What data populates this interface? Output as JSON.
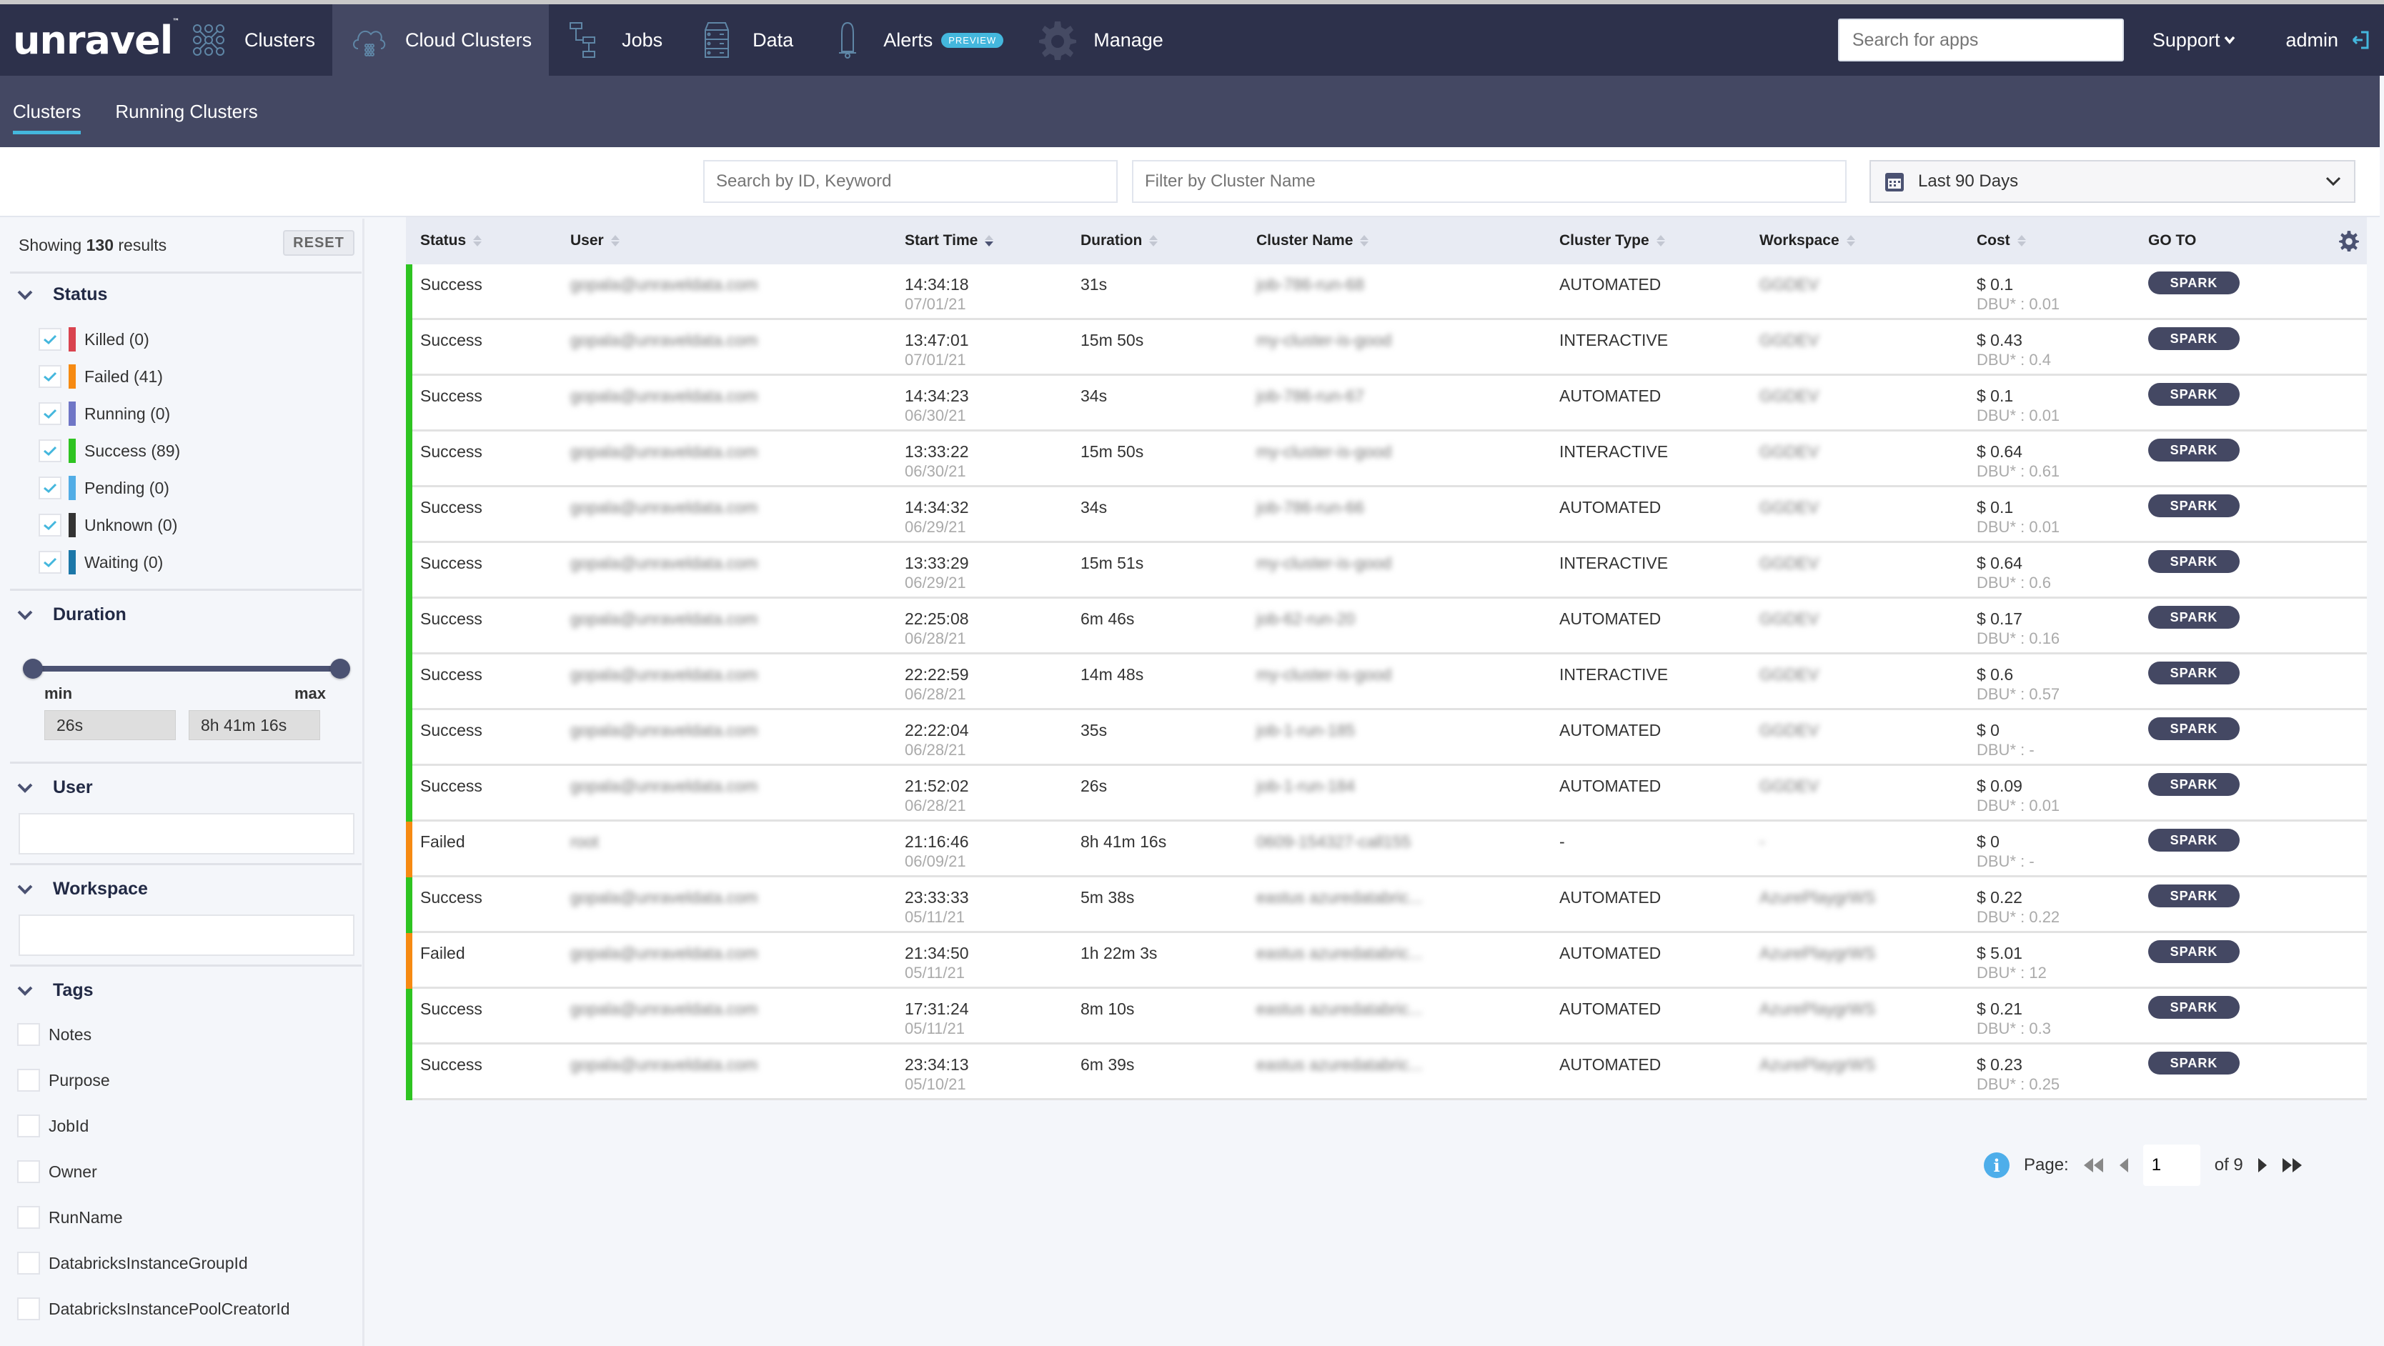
{
  "app": {
    "logo": "unravel"
  },
  "nav": [
    {
      "label": "Clusters",
      "icon": "clusters-icon",
      "active": false
    },
    {
      "label": "Cloud Clusters",
      "icon": "cloud-clusters-icon",
      "active": true
    },
    {
      "label": "Jobs",
      "icon": "jobs-icon",
      "active": false
    },
    {
      "label": "Data",
      "icon": "data-icon",
      "active": false
    },
    {
      "label": "Alerts",
      "icon": "bell-icon",
      "active": false,
      "badge": "PREVIEW"
    },
    {
      "label": "Manage",
      "icon": "gear-icon",
      "active": false
    }
  ],
  "top_right": {
    "search_placeholder": "Search for apps",
    "support_label": "Support",
    "user_label": "admin"
  },
  "subnav": {
    "tabs": [
      {
        "label": "Clusters",
        "active": true
      },
      {
        "label": "Running Clusters",
        "active": false
      }
    ]
  },
  "filters": {
    "search_placeholder": "Search by ID, Keyword",
    "cluster_name_placeholder": "Filter by Cluster Name",
    "date_range": "Last 90 Days"
  },
  "sidebar": {
    "showing_prefix": "Showing",
    "showing_count": "130",
    "showing_suffix": "results",
    "reset_label": "RESET",
    "status": {
      "title": "Status",
      "items": [
        {
          "label": "Killed (0)",
          "color": "#d9434f",
          "checked": true
        },
        {
          "label": "Failed (41)",
          "color": "#f68a12",
          "checked": true
        },
        {
          "label": "Running (0)",
          "color": "#6f76c6",
          "checked": true
        },
        {
          "label": "Success (89)",
          "color": "#2ec421",
          "checked": true
        },
        {
          "label": "Pending (0)",
          "color": "#52ade6",
          "checked": true
        },
        {
          "label": "Unknown (0)",
          "color": "#333333",
          "checked": true
        },
        {
          "label": "Waiting (0)",
          "color": "#1c77a8",
          "checked": true
        }
      ]
    },
    "duration": {
      "title": "Duration",
      "min_label": "min",
      "max_label": "max",
      "min_value": "26s",
      "max_value": "8h 41m 16s",
      "range_fraction": [
        0,
        1
      ]
    },
    "user": {
      "title": "User",
      "value": ""
    },
    "workspace": {
      "title": "Workspace",
      "value": ""
    },
    "tags": {
      "title": "Tags",
      "items": [
        "Notes",
        "Purpose",
        "JobId",
        "Owner",
        "RunName",
        "DatabricksInstanceGroupId",
        "DatabricksInstancePoolCreatorId"
      ]
    }
  },
  "table": {
    "columns": [
      "Status",
      "User",
      "Start Time",
      "Duration",
      "Cluster Name",
      "Cluster Type",
      "Workspace",
      "Cost",
      "GO TO"
    ],
    "status_colors": {
      "Success": "#2ec421",
      "Failed": "#f68a12"
    },
    "rows": [
      {
        "status": "Success",
        "user": "gopala@unraveldata.com",
        "time": "14:34:18",
        "date": "07/01/21",
        "duration": "31s",
        "cluster": "job-786-run-68",
        "type": "AUTOMATED",
        "workspace": "GGDEV",
        "cost": "$ 0.1",
        "dbu": "DBU* : 0.01",
        "goto": "SPARK"
      },
      {
        "status": "Success",
        "user": "gopala@unraveldata.com",
        "time": "13:47:01",
        "date": "07/01/21",
        "duration": "15m 50s",
        "cluster": "my-cluster-is-good",
        "type": "INTERACTIVE",
        "workspace": "GGDEV",
        "cost": "$ 0.43",
        "dbu": "DBU* : 0.4",
        "goto": "SPARK"
      },
      {
        "status": "Success",
        "user": "gopala@unraveldata.com",
        "time": "14:34:23",
        "date": "06/30/21",
        "duration": "34s",
        "cluster": "job-786-run-67",
        "type": "AUTOMATED",
        "workspace": "GGDEV",
        "cost": "$ 0.1",
        "dbu": "DBU* : 0.01",
        "goto": "SPARK"
      },
      {
        "status": "Success",
        "user": "gopala@unraveldata.com",
        "time": "13:33:22",
        "date": "06/30/21",
        "duration": "15m 50s",
        "cluster": "my-cluster-is-good",
        "type": "INTERACTIVE",
        "workspace": "GGDEV",
        "cost": "$ 0.64",
        "dbu": "DBU* : 0.61",
        "goto": "SPARK"
      },
      {
        "status": "Success",
        "user": "gopala@unraveldata.com",
        "time": "14:34:32",
        "date": "06/29/21",
        "duration": "34s",
        "cluster": "job-786-run-66",
        "type": "AUTOMATED",
        "workspace": "GGDEV",
        "cost": "$ 0.1",
        "dbu": "DBU* : 0.01",
        "goto": "SPARK"
      },
      {
        "status": "Success",
        "user": "gopala@unraveldata.com",
        "time": "13:33:29",
        "date": "06/29/21",
        "duration": "15m 51s",
        "cluster": "my-cluster-is-good",
        "type": "INTERACTIVE",
        "workspace": "GGDEV",
        "cost": "$ 0.64",
        "dbu": "DBU* : 0.6",
        "goto": "SPARK"
      },
      {
        "status": "Success",
        "user": "gopala@unraveldata.com",
        "time": "22:25:08",
        "date": "06/28/21",
        "duration": "6m 46s",
        "cluster": "job-62-run-20",
        "type": "AUTOMATED",
        "workspace": "GGDEV",
        "cost": "$ 0.17",
        "dbu": "DBU* : 0.16",
        "goto": "SPARK"
      },
      {
        "status": "Success",
        "user": "gopala@unraveldata.com",
        "time": "22:22:59",
        "date": "06/28/21",
        "duration": "14m 48s",
        "cluster": "my-cluster-is-good",
        "type": "INTERACTIVE",
        "workspace": "GGDEV",
        "cost": "$ 0.6",
        "dbu": "DBU* : 0.57",
        "goto": "SPARK"
      },
      {
        "status": "Success",
        "user": "gopala@unraveldata.com",
        "time": "22:22:04",
        "date": "06/28/21",
        "duration": "35s",
        "cluster": "job-1-run-185",
        "type": "AUTOMATED",
        "workspace": "GGDEV",
        "cost": "$ 0",
        "dbu": "DBU* : -",
        "goto": "SPARK"
      },
      {
        "status": "Success",
        "user": "gopala@unraveldata.com",
        "time": "21:52:02",
        "date": "06/28/21",
        "duration": "26s",
        "cluster": "job-1-run-184",
        "type": "AUTOMATED",
        "workspace": "GGDEV",
        "cost": "$ 0.09",
        "dbu": "DBU* : 0.01",
        "goto": "SPARK"
      },
      {
        "status": "Failed",
        "user": "root",
        "time": "21:16:46",
        "date": "06/09/21",
        "duration": "8h 41m 16s",
        "cluster": "0609-154327-call155",
        "type": "-",
        "workspace": "-",
        "cost": "$ 0",
        "dbu": "DBU* : -",
        "goto": "SPARK"
      },
      {
        "status": "Success",
        "user": "gopala@unraveldata.com",
        "time": "23:33:33",
        "date": "05/11/21",
        "duration": "5m 38s",
        "cluster": "eastus azuredatabric...",
        "type": "AUTOMATED",
        "workspace": "AzurePlaygrWS",
        "cost": "$ 0.22",
        "dbu": "DBU* : 0.22",
        "goto": "SPARK"
      },
      {
        "status": "Failed",
        "user": "gopala@unraveldata.com",
        "time": "21:34:50",
        "date": "05/11/21",
        "duration": "1h 22m 3s",
        "cluster": "eastus azuredatabric...",
        "type": "AUTOMATED",
        "workspace": "AzurePlaygrWS",
        "cost": "$ 5.01",
        "dbu": "DBU* : 12",
        "goto": "SPARK"
      },
      {
        "status": "Success",
        "user": "gopala@unraveldata.com",
        "time": "17:31:24",
        "date": "05/11/21",
        "duration": "8m 10s",
        "cluster": "eastus azuredatabric...",
        "type": "AUTOMATED",
        "workspace": "AzurePlaygrWS",
        "cost": "$ 0.21",
        "dbu": "DBU* : 0.3",
        "goto": "SPARK"
      },
      {
        "status": "Success",
        "user": "gopala@unraveldata.com",
        "time": "23:34:13",
        "date": "05/10/21",
        "duration": "6m 39s",
        "cluster": "eastus azuredatabric...",
        "type": "AUTOMATED",
        "workspace": "AzurePlaygrWS",
        "cost": "$ 0.23",
        "dbu": "DBU* : 0.25",
        "goto": "SPARK"
      }
    ]
  },
  "pagination": {
    "label": "Page:",
    "current": "1",
    "total_label": "of 9"
  },
  "colors": {
    "topbar": "#2d314b",
    "subnav": "#444863",
    "accent": "#44b7dd"
  }
}
